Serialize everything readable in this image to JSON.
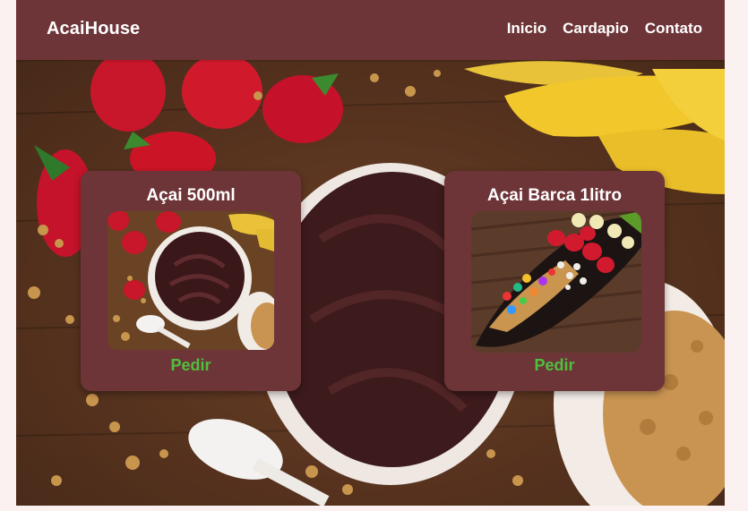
{
  "navbar": {
    "brand": "AcaiHouse",
    "links": [
      "Inicio",
      "Cardapio",
      "Contato"
    ]
  },
  "hero": {
    "background_image": "acai bowl with strawberries, bananas and granola on wooden table"
  },
  "products": [
    {
      "name": "Açai 500ml",
      "image": "acai cup with strawberries and banana",
      "button": "Pedir"
    },
    {
      "name": "Açai Barca 1litro",
      "image": "acai boat with fruits, candies and granola",
      "button": "Pedir"
    }
  ],
  "colors": {
    "primary": "#6e3538",
    "button_text": "#4fbf3f",
    "text": "#ffffff",
    "page_bg": "#fbf1f1"
  }
}
